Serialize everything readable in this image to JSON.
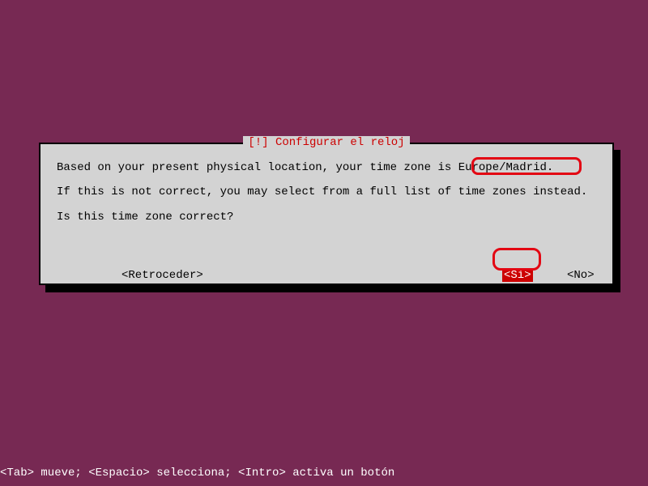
{
  "dialog": {
    "title": "[!] Configurar el reloj",
    "line1_prefix": "Based on your present physical location, your time zone is ",
    "timezone": "Europe/Madrid",
    "line1_suffix": ".",
    "line2": "If this is not correct, you may select from a full list of time zones instead.",
    "line3": "Is this time zone correct?",
    "back_label": "<Retroceder>",
    "yes_label": "<Sí>",
    "no_label": "<No>"
  },
  "help": "<Tab> mueve; <Espacio> selecciona; <Intro> activa un botón"
}
